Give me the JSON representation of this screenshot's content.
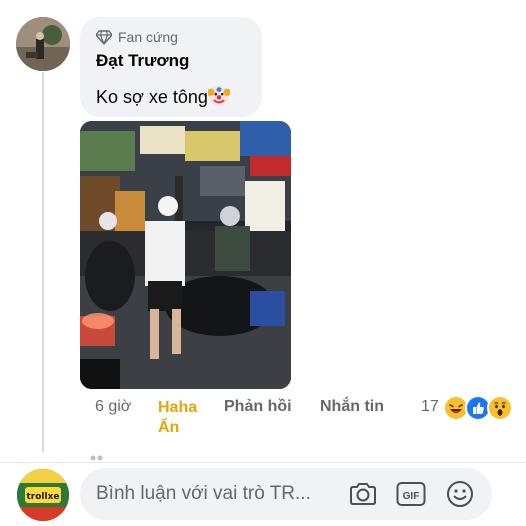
{
  "comment": {
    "badge": "Fan cứng",
    "author": "Đạt Trương",
    "text": "Ko sợ xe tông",
    "text_emoji": "clown-face-icon"
  },
  "actions": {
    "time": "6 giờ",
    "haha": "Haha",
    "hide": "Ẩn",
    "reply": "Phản hồi",
    "message": "Nhắn tin",
    "reaction_count": "17",
    "reaction_icons": [
      "haha-reaction-icon",
      "like-reaction-icon",
      "wow-reaction-icon"
    ]
  },
  "composer": {
    "placeholder": "Bình luận với vai trò TR...",
    "icons": [
      "camera-icon",
      "gif-icon",
      "emoji-icon"
    ]
  },
  "composer_avatar_text": "trollxe",
  "colors": {
    "haha": "#e5a50a",
    "secondary_text": "#65676b",
    "bubble": "#f0f2f5",
    "like_blue": "#1877f2"
  }
}
